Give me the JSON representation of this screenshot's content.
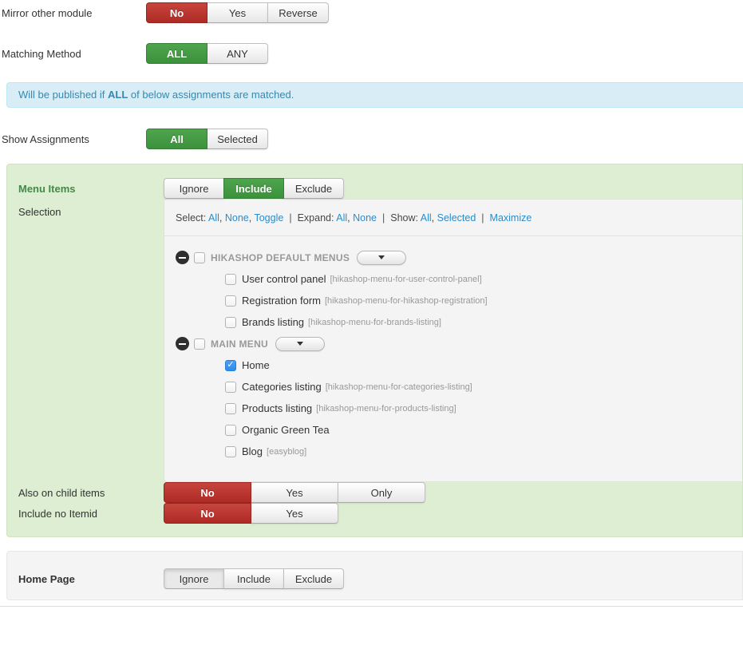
{
  "colors": {
    "danger": "#bd362f",
    "success": "#459a45",
    "info_text": "#3a87ad",
    "info_bg": "#d9edf7",
    "link": "#2a8ccc",
    "panel_green_bg": "#ddeed3",
    "panel_gray_bg": "#f4f4f4"
  },
  "fields": {
    "mirror_other_module": {
      "label": "Mirror other module",
      "options": [
        "No",
        "Yes",
        "Reverse"
      ],
      "selected": "No",
      "selected_style": "danger"
    },
    "matching_method": {
      "label": "Matching Method",
      "options": [
        "ALL",
        "ANY"
      ],
      "selected": "ALL",
      "selected_style": "success"
    },
    "show_assignments": {
      "label": "Show Assignments",
      "options": [
        "All",
        "Selected"
      ],
      "selected": "All",
      "selected_style": "success"
    },
    "menu_items": {
      "label": "Menu Items",
      "options": [
        "Ignore",
        "Include",
        "Exclude"
      ],
      "selected": "Include",
      "selected_style": "success"
    },
    "also_on_child_items": {
      "label": "Also on child items",
      "options": [
        "No",
        "Yes",
        "Only"
      ],
      "selected": "No",
      "selected_style": "danger"
    },
    "include_no_itemid": {
      "label": "Include no Itemid",
      "options": [
        "No",
        "Yes"
      ],
      "selected": "No",
      "selected_style": "danger"
    },
    "home_page": {
      "label": "Home Page",
      "options": [
        "Ignore",
        "Include",
        "Exclude"
      ],
      "selected": "Ignore",
      "selected_style": "neutral"
    }
  },
  "alert": {
    "prefix": "Will be published if ",
    "bold": "ALL",
    "suffix": " of below assignments are matched."
  },
  "selection": {
    "label": "Selection",
    "toolbar": [
      {
        "label": "Select:",
        "links": [
          "All",
          "None",
          "Toggle"
        ]
      },
      {
        "label": "Expand:",
        "links": [
          "All",
          "None"
        ]
      },
      {
        "label": "Show:",
        "links": [
          "All",
          "Selected"
        ]
      },
      {
        "label": "",
        "links": [
          "Maximize"
        ]
      }
    ],
    "tree": [
      {
        "type": "group",
        "label": "HIKASHOP DEFAULT MENUS",
        "checked": false,
        "icon": "minus-circle-icon",
        "dropdown": "caret-down-icon"
      },
      {
        "type": "item",
        "label": "User control panel",
        "alias": "[hikashop-menu-for-user-control-panel]",
        "checked": false
      },
      {
        "type": "item",
        "label": "Registration form",
        "alias": "[hikashop-menu-for-hikashop-registration]",
        "checked": false
      },
      {
        "type": "item",
        "label": "Brands listing",
        "alias": "[hikashop-menu-for-brands-listing]",
        "checked": false
      },
      {
        "type": "group",
        "label": "MAIN MENU",
        "checked": false,
        "icon": "minus-circle-icon",
        "dropdown": "caret-down-icon"
      },
      {
        "type": "item",
        "label": "Home",
        "alias": "",
        "checked": true
      },
      {
        "type": "item",
        "label": "Categories listing",
        "alias": "[hikashop-menu-for-categories-listing]",
        "checked": false
      },
      {
        "type": "item",
        "label": "Products listing",
        "alias": "[hikashop-menu-for-products-listing]",
        "checked": false
      },
      {
        "type": "item",
        "label": "Organic Green Tea",
        "alias": "",
        "checked": false
      },
      {
        "type": "item",
        "label": "Blog",
        "alias": "[easyblog]",
        "checked": false
      }
    ]
  }
}
